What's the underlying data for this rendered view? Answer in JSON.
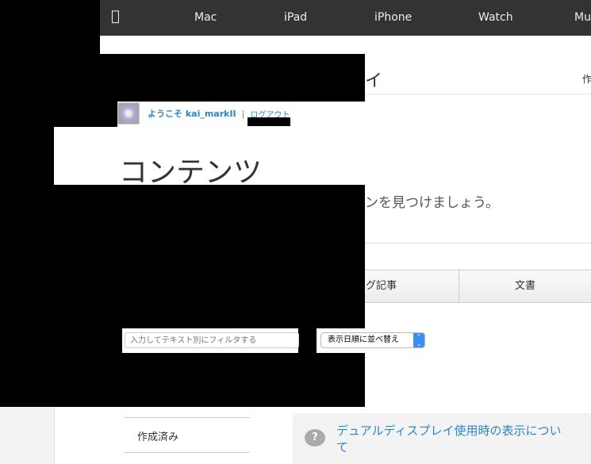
{
  "nav": {
    "items": [
      "Mac",
      "iPad",
      "iPhone",
      "Watch",
      "Mu"
    ]
  },
  "header": {
    "title_fragment": "イ",
    "right_fragment": "作"
  },
  "welcome": {
    "text": "ようこそ kai_markII",
    "separator": "|",
    "logout": "ログアウト"
  },
  "content": {
    "title": "コンテンツ",
    "subtitle_fragment": "ンを見つけましょう。"
  },
  "tabs": [
    "ログ記事",
    "文書"
  ],
  "filter": {
    "placeholder": "入力してテキスト別にフィルタする"
  },
  "sort": {
    "selected": "表示日順に並べ替え"
  },
  "sidebar": {
    "item": "作成済み"
  },
  "help": {
    "link": "デュアルディスプレイ使用時の表示について"
  }
}
